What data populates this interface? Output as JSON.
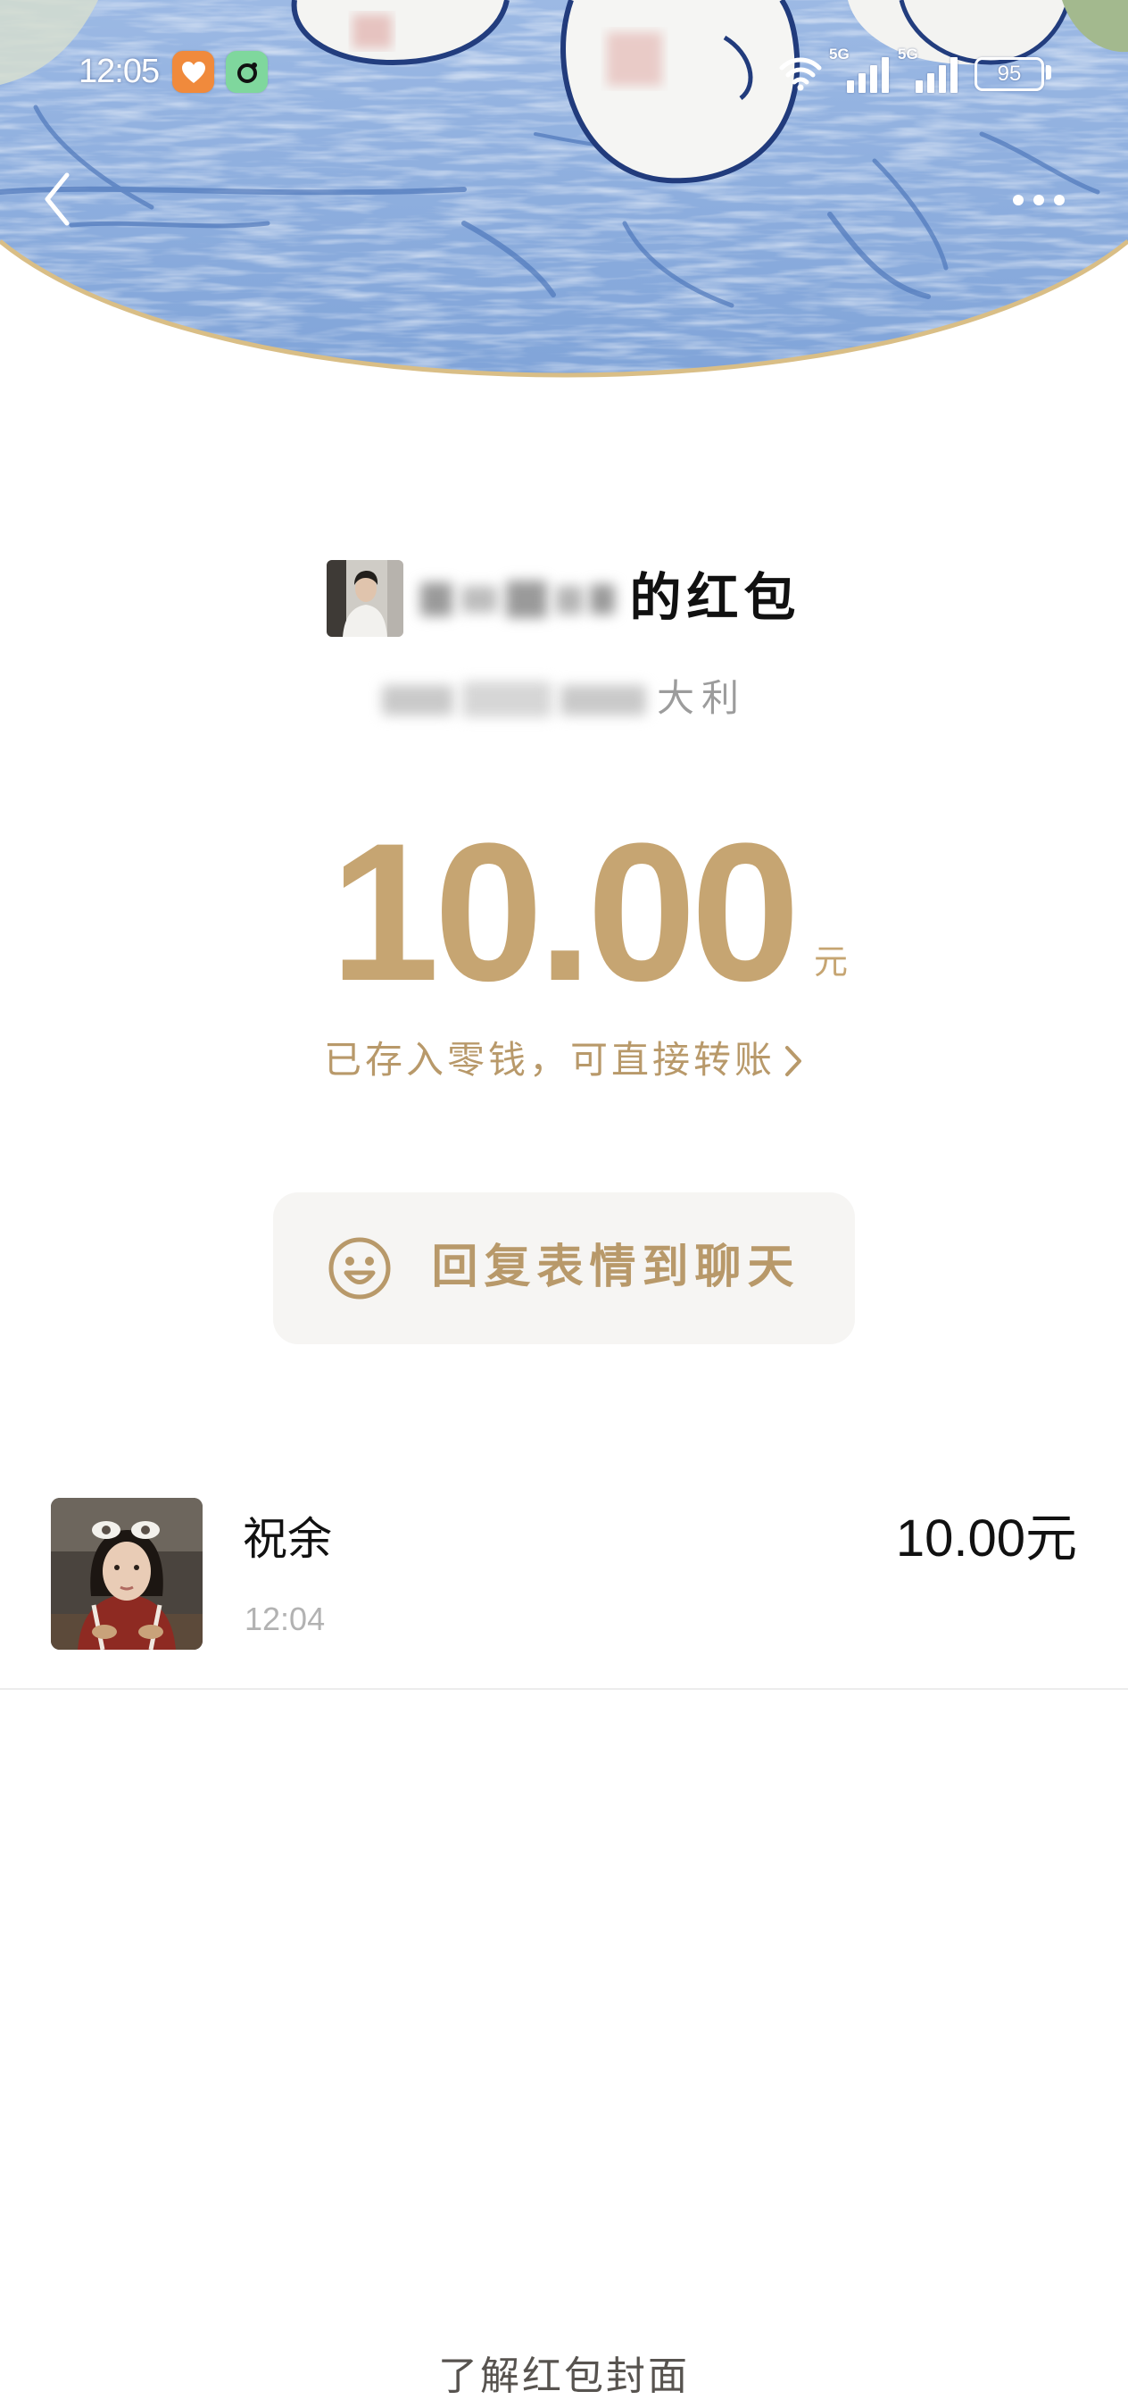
{
  "status_bar": {
    "time": "12:05",
    "app_icons": [
      "heart-app-icon",
      "camera-app-icon"
    ],
    "wifi_icon": "wifi-icon",
    "signal_1_label": "5G",
    "signal_2_label": "5G",
    "battery": "95"
  },
  "nav": {
    "back_icon": "chevron-left-icon",
    "more_icon": "more-horizontal-icon"
  },
  "sender": {
    "packet_label": "的红包",
    "greeting_visible": "大利"
  },
  "amount": {
    "value": "10.00",
    "unit": "元"
  },
  "wallet_note": {
    "text": "已存入零钱，可直接转账",
    "icon": "chevron-right-icon"
  },
  "reply_button": {
    "label": "回复表情到聊天",
    "icon": "smiley-icon"
  },
  "receivers": [
    {
      "name": "祝余",
      "time": "12:04",
      "amount": "10.00元"
    }
  ],
  "footer": {
    "link": "了解红包封面"
  },
  "colors": {
    "gold": "#c6a572",
    "gold_text": "#b8996a",
    "button_bg": "#f6f5f3",
    "cover_blue": "#86a8db",
    "cover_border": "#d9be86",
    "divider": "#ececec"
  }
}
